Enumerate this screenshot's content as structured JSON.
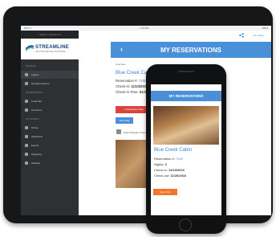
{
  "tablet": {
    "status_bar": {
      "left": "iPad ✦",
      "center": "7:19 PM",
      "right": "100%"
    },
    "sidebar": {
      "top_label": "Update / Dashboard",
      "logo": {
        "name": "STREAMLINE",
        "tagline": "VACATION RENTAL SOFTWARE"
      },
      "section_1": "MANAGE",
      "items": [
        {
          "label": "Logout",
          "icon": "power-icon",
          "active": true
        },
        {
          "label": "My Reservations",
          "icon": "calendar-icon",
          "active": false
        }
      ],
      "section_2": "INFORMATION",
      "items_2": [
        {
          "label": "Local Info",
          "icon": "info-icon"
        },
        {
          "label": "Directions",
          "icon": "map-pin-icon"
        }
      ],
      "section_3": "ACTIVITIES",
      "items_3": [
        {
          "label": "Dining",
          "icon": "fork-icon"
        },
        {
          "label": "Attractions",
          "icon": "camera-icon"
        },
        {
          "label": "Events",
          "icon": "star-icon"
        },
        {
          "label": "Shopping",
          "icon": "bag-icon"
        },
        {
          "label": "Weather",
          "icon": "cloud-icon"
        }
      ]
    },
    "topbar": {
      "share_icon": "share-icon",
      "greeting": "Hi, Guest"
    },
    "header": {
      "back": "‹",
      "title": "MY RESERVATIONS"
    },
    "breadcrumb": "Overview",
    "reservation": {
      "cabin": "Blue Creek Cabin",
      "res_label": "Reservation #: ",
      "res_value": "7100",
      "checkin_label": "Check-in: ",
      "checkin_value": "11/23/2016",
      "checkin_time_label": "Check-in Time: ",
      "checkin_time_value": "04:00 PM",
      "button_primary": "Unlock Door Now",
      "button_secondary": "View Map",
      "repair_label": "Submit Repair Ticket"
    }
  },
  "phone": {
    "header_title": "MY RESERVATIONS",
    "cabin": "Blue Creek Cabin",
    "lines": [
      {
        "label": "Reservation #: ",
        "value": "7100"
      },
      {
        "label": "Nights: ",
        "value": "3"
      },
      {
        "label": "Check-in: ",
        "value": "11/23/2016"
      },
      {
        "label": "Check-out: ",
        "value": "11/26/2016"
      }
    ],
    "button": "View Info ›"
  },
  "colors": {
    "accent": "#4a90d9",
    "danger": "#d9453d",
    "orange": "#f0772c",
    "sidebar": "#2e3033"
  }
}
